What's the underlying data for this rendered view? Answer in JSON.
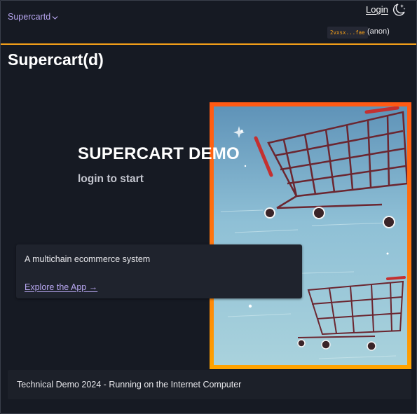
{
  "header": {
    "brand_menu_label": "Supercartd",
    "login_label": "Login",
    "principal_id": "2vxsx...fae",
    "principal_status": "(anon)",
    "accent_color": "#f5a019"
  },
  "page": {
    "title": "Supercart(d)"
  },
  "hero": {
    "heading": "SUPERCART DEMO",
    "subheading": "login to start"
  },
  "info_card": {
    "text": "A multichain ecommerce system",
    "link_label": "Explore the App →"
  },
  "footer": {
    "text": "Technical Demo 2024 - Running on the Internet Computer"
  },
  "icons": {
    "brand_chevron": "chevron-down-icon",
    "theme": "moon-stars-icon"
  }
}
